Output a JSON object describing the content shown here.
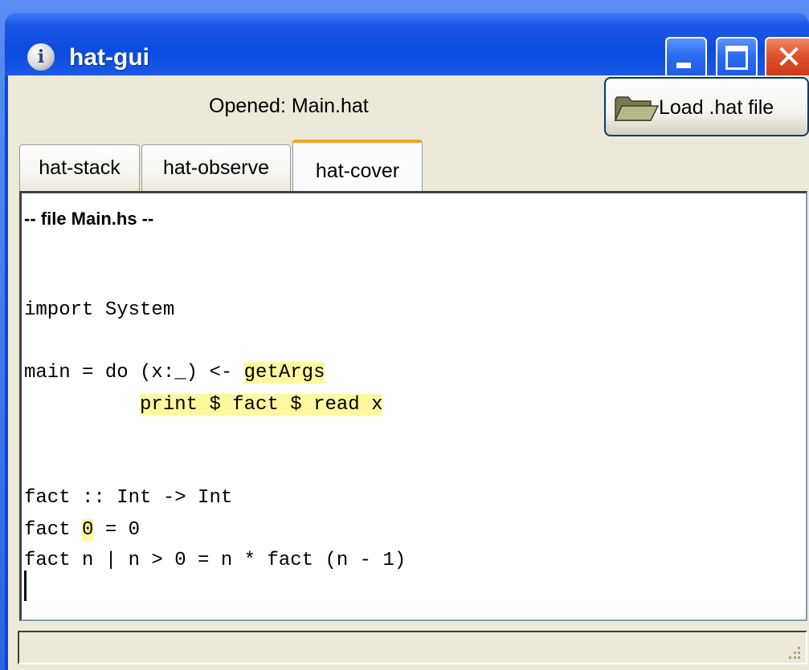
{
  "window": {
    "title": "hat-gui",
    "info_icon": "i",
    "controls": {
      "minimize": "minimize-icon",
      "maximize": "maximize-icon",
      "close": "✕"
    }
  },
  "header": {
    "status": "Opened: Main.hat",
    "load_button": {
      "label": "Load .hat file",
      "icon": "folder-icon"
    }
  },
  "tabs": [
    {
      "label": "hat-stack",
      "selected": false
    },
    {
      "label": "hat-observe",
      "selected": false
    },
    {
      "label": "hat-cover",
      "selected": true
    }
  ],
  "code": {
    "header": "-- file Main.hs --",
    "l1": "import System",
    "l2_a": "main = do (x:_) <- ",
    "l2_b": "getArgs",
    "l3_indent": "          ",
    "l3_b": "print $ fact $ read x",
    "l4": "fact :: Int -> Int",
    "l5_a": "fact ",
    "l5_b": "0",
    "l5_c": " = 0",
    "l6": "fact n | n > 0 = n * fact (n - 1)"
  },
  "colors": {
    "highlight": "#fff7a0",
    "selected_tab_accent": "#f7a21b",
    "titlebar": "#0b4be0"
  },
  "statusbar": {
    "text": ""
  }
}
